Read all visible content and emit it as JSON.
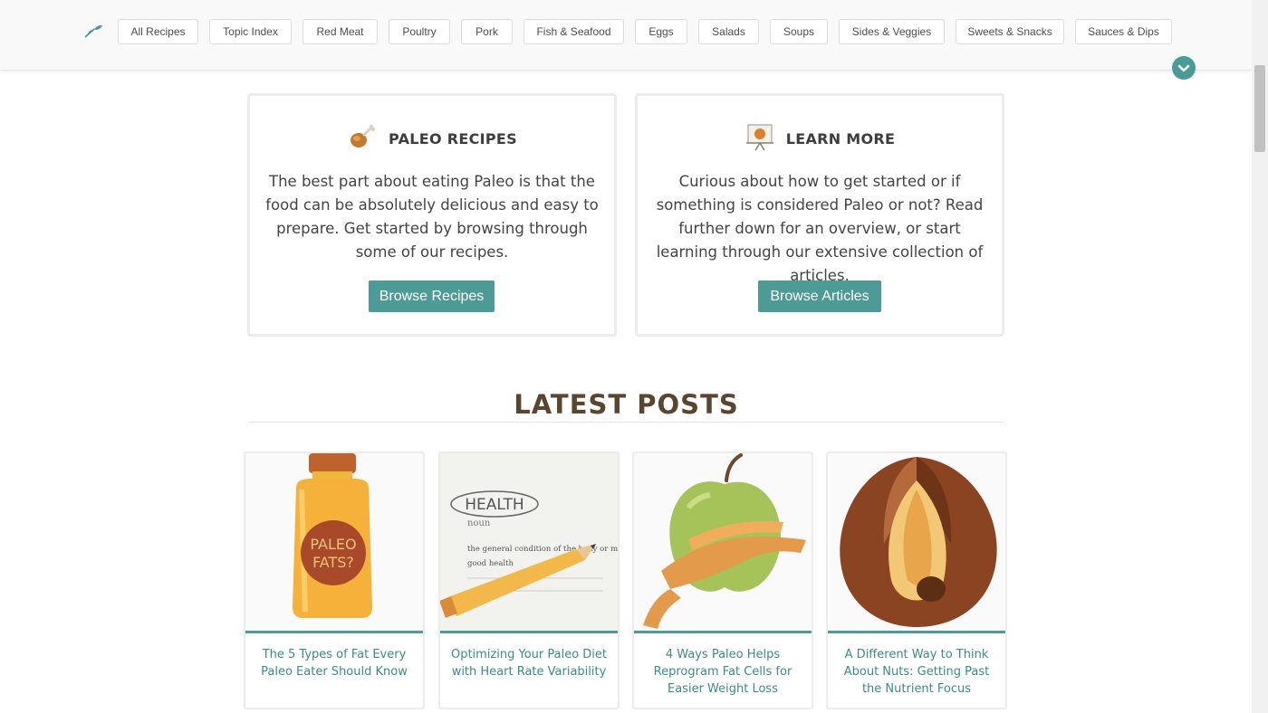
{
  "nav": {
    "items": [
      {
        "label": "All Recipes"
      },
      {
        "label": "Topic Index"
      },
      {
        "label": "Red Meat"
      },
      {
        "label": "Poultry"
      },
      {
        "label": "Pork"
      },
      {
        "label": "Fish & Seafood"
      },
      {
        "label": "Eggs"
      },
      {
        "label": "Salads"
      },
      {
        "label": "Soups"
      },
      {
        "label": "Sides & Veggies"
      },
      {
        "label": "Sweets & Snacks"
      },
      {
        "label": "Sauces & Dips"
      }
    ],
    "logo_icon": "paleo-leaf-logo-icon",
    "expand_icon": "chevron-down-icon"
  },
  "cards": {
    "recipes": {
      "title": "PALEO RECIPES",
      "text": "The best part about eating Paleo is that the food can be absolutely delicious and easy to prepare. Get started by browsing through some of our recipes.",
      "button": "Browse Recipes",
      "icon": "drumstick-icon"
    },
    "learn": {
      "title": "LEARN MORE",
      "text": "Curious about how to get started or if something is considered Paleo or not? Read further down for an overview, or start learning through our extensive collection of articles.",
      "button": "Browse Articles",
      "icon": "presentation-board-icon"
    }
  },
  "latest": {
    "heading": "LATEST POSTS",
    "posts": [
      {
        "title": "The 5 Types of Fat Every Paleo Eater Should Know",
        "image": "oil-jar-image",
        "image_text": [
          "PALEO",
          "FATS?"
        ]
      },
      {
        "title": "Optimizing Your Paleo Diet with Heart Rate Variability",
        "image": "health-definition-pencil-image",
        "image_text": [
          "HEALTH",
          "noun",
          "the general condition of the body or mind",
          "good health"
        ]
      },
      {
        "title": "4 Ways Paleo Helps Reprogram Fat Cells for Easier Weight Loss",
        "image": "apple-measuring-tape-image"
      },
      {
        "title": "A Different Way to Think About Nuts: Getting Past the Nutrient Focus",
        "image": "cracked-nut-image"
      }
    ]
  },
  "colors": {
    "accent": "#4d9a96",
    "heading_brown": "#5a4530",
    "post_link": "#3d8a86"
  }
}
